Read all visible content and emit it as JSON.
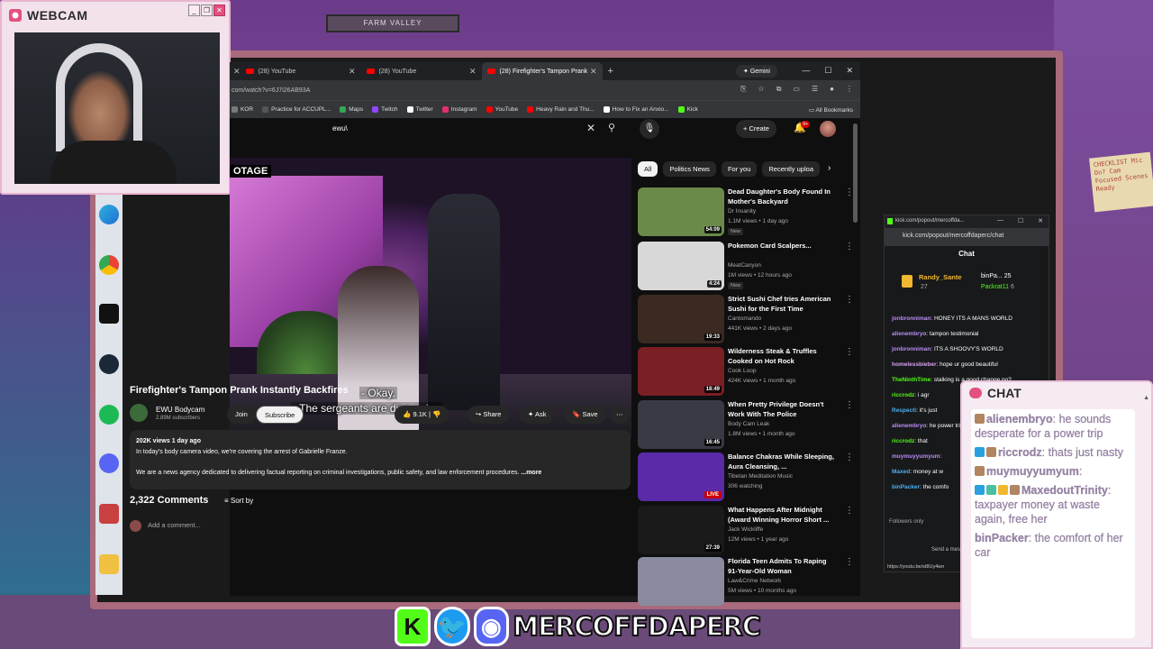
{
  "webcam": {
    "title": "WEBCAM"
  },
  "scene": {
    "sign_text": "FARM VALLEY",
    "note_text": "CHECKLIST Mic On? Cam Focused Scenes Ready"
  },
  "browser": {
    "tabs": [
      {
        "label": "(28) YouTube",
        "active": false
      },
      {
        "label": "(28) YouTube",
        "active": false
      },
      {
        "label": "(28) Firefighter's Tampon Prank",
        "active": true
      }
    ],
    "gemini_label": "Gemini",
    "url": "com/watch?v=6J7i26AB93A",
    "bookmarks": [
      {
        "label": "KOR",
        "color": "#7a7a7a"
      },
      {
        "label": "Practice for ACCUPL...",
        "color": "#555"
      },
      {
        "label": "Maps",
        "color": "#34a853"
      },
      {
        "label": "Twitch",
        "color": "#9146ff"
      },
      {
        "label": "Twitter",
        "color": "#ffffff"
      },
      {
        "label": "Instagram",
        "color": "#e1306c"
      },
      {
        "label": "YouTube",
        "color": "#ff0000"
      },
      {
        "label": "Heavy Rain and Thu...",
        "color": "#ff0000"
      },
      {
        "label": "How to Fix an Anxio...",
        "color": "#ffffff"
      },
      {
        "label": "Kick",
        "color": "#53fc18"
      }
    ],
    "all_bookmarks": "All Bookmarks"
  },
  "youtube": {
    "search_value": "ewu\\",
    "create_label": "Create",
    "notif_count": "9+",
    "video": {
      "footage_tag": "OTAGE",
      "subtitle_1": "- Okay.",
      "subtitle_2": "- The sergeants are discussing",
      "title": "Firefighter's Tampon Prank Instantly Backfires",
      "channel": "EWU Bodycam",
      "subscribers": "2.89M subscribers",
      "join": "Join",
      "subscribe": "Subscribe",
      "likes": "9.1K",
      "share": "Share",
      "ask": "Ask",
      "save": "Save",
      "views_date": "202K views  1 day ago",
      "desc_line1": "In today's body camera video, we're covering the arrest of Gabrielle Franze.",
      "desc_line2": "We are a news agency dedicated to delivering factual reporting on criminal investigations, public safety, and law enforcement procedures.",
      "more": "...more",
      "comments_count": "2,322 Comments",
      "sort_by": "Sort by",
      "add_comment": "Add a comment..."
    },
    "chips": [
      "All",
      "Politics News",
      "For you",
      "Recently uploa"
    ],
    "recommendations": [
      {
        "title": "Dead Daughter's Body Found In Mother's Backyard",
        "channel": "Dr Insanity",
        "meta": "1.1M views • 1 day ago",
        "badge": "New",
        "duration": "54:09",
        "thumb": "#6a8a4a"
      },
      {
        "title": "Pokemon Card Scalpers...",
        "channel": "MeatCanyon",
        "meta": "1M views • 12 hours ago",
        "badge": "New",
        "duration": "4:24",
        "thumb": "#d8d8d8"
      },
      {
        "title": "Strict Sushi Chef tries American Sushi for the First Time",
        "channel": "Cantomando",
        "meta": "441K views • 2 days ago",
        "badge": "",
        "duration": "19:33",
        "thumb": "#3a2a22"
      },
      {
        "title": "Wilderness Steak & Truffles Cooked on Hot Rock",
        "channel": "Cook Loop",
        "meta": "424K views • 1 month ago",
        "badge": "",
        "duration": "18:49",
        "thumb": "#7a1f24"
      },
      {
        "title": "When Pretty Privilege Doesn't Work With The Police",
        "channel": "Body Cam Leak",
        "meta": "1.8M views • 1 month ago",
        "badge": "",
        "duration": "16:45",
        "thumb": "#3a3a44"
      },
      {
        "title": "Balance Chakras While Sleeping, Aura Cleansing, ...",
        "channel": "Tibetan Meditation Music",
        "meta": "306 watching",
        "badge": "",
        "duration": "LIVE",
        "thumb": "#5a2aa8"
      },
      {
        "title": "What Happens After Midnight (Award Winning Horror Short ...",
        "channel": "Jack Wickliffe",
        "meta": "12M views • 1 year ago",
        "badge": "",
        "duration": "27:39",
        "thumb": "#1a1a1a"
      },
      {
        "title": "Florida Teen Admits To Raping 91-Year-Old Woman",
        "channel": "Law&Crime Network",
        "meta": "5M views • 10 months ago",
        "badge": "",
        "duration": "",
        "thumb": "#8a8aa0"
      }
    ]
  },
  "kick": {
    "window_title": "kick.com/popout/mercoffda...",
    "url": "kick.com/popout/mercoffdaperc/chat",
    "chat_heading": "Chat",
    "top_gifter": "Randy_Sante",
    "top_gifter_count": "27",
    "gifter2": "binPa...",
    "gifter2_count": "25",
    "gifter3": "Packrat11",
    "gifter3_count": "6",
    "messages": [
      {
        "user": "jonbronniman",
        "text": "HONEY ITS A MANS WORLD",
        "color": "#b88cf2"
      },
      {
        "user": "alienembryo",
        "text": "tampon testimonial",
        "color": "#b88cf2"
      },
      {
        "user": "jonbronniman",
        "text": "ITS A SHOOVY'S WORLD",
        "color": "#b88cf2"
      },
      {
        "user": "homelessbieber",
        "text": "hope ur good beautiful",
        "color": "#d8a0f0"
      },
      {
        "user": "TheNinthTime",
        "text": "stalking is a good change po?",
        "color": "#53fc18"
      },
      {
        "user": "riccrodz",
        "text": "i agr",
        "color": "#53fc18"
      },
      {
        "user": "Respecti",
        "text": "it's just",
        "color": "#4ab0f0"
      },
      {
        "user": "alienembryo",
        "text": "he power trip",
        "color": "#b88cf2"
      },
      {
        "user": "riccrodz",
        "text": "that",
        "color": "#53fc18"
      },
      {
        "user": "muymuyyumyum",
        "text": "",
        "color": "#b88cf2"
      },
      {
        "user": "Maxed",
        "text": "money at w",
        "color": "#4ab0f0"
      },
      {
        "user": "binPacker",
        "text": "the comfo",
        "color": "#4ab0f0"
      }
    ],
    "followers_only": "Followers only",
    "send_label": "Send a message",
    "link_preview": "https://youtu.be/st8Uy4wn"
  },
  "chat_overlay": {
    "title": "CHAT",
    "messages": [
      {
        "user": "alienembryo",
        "text": "he sounds desperate for a power trip",
        "icons": [
          "#b08560"
        ]
      },
      {
        "user": "riccrodz",
        "text": "thats just nasty",
        "icons": [
          "#2aa0e0",
          "#b08560"
        ]
      },
      {
        "user": "muymuyyumyum",
        "text": "",
        "icons": [
          "#b08560"
        ]
      },
      {
        "user": "MaxedoutTrinity",
        "text": "taxpayer money at waste again, free her",
        "icons": [
          "#2aa0e0",
          "#4ac0a0",
          "#f0b72f",
          "#b08560"
        ]
      },
      {
        "user": "binPacker",
        "text": "the comfort of her car",
        "icons": []
      }
    ]
  },
  "banner": {
    "name": "MERCOFFDAPERC"
  }
}
